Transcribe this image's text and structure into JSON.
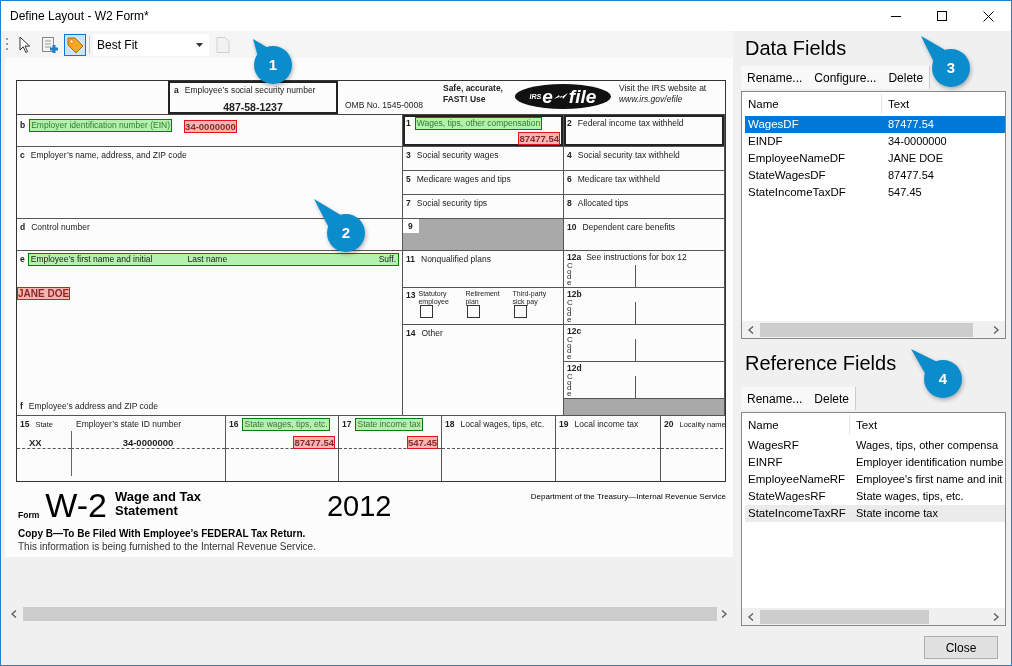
{
  "window": {
    "title": "Define Layout - W2 Form*"
  },
  "toolbar": {
    "tools": [
      {
        "kind": "pointer",
        "selected": false
      },
      {
        "kind": "add-field",
        "selected": false
      },
      {
        "kind": "tag",
        "selected": true
      }
    ],
    "zoom": "Best Fit",
    "page_button": {
      "disabled": true
    }
  },
  "form": {
    "ssn": {
      "letter": "a",
      "label": "Employee’s social security number",
      "value": "487-58-1237"
    },
    "omb": "OMB No. 1545-0008",
    "efile": {
      "note": "Safe, accurate, FAST! Use",
      "logo_badge": "IRS",
      "logo_left": "e",
      "logo_right": "file",
      "visit": "Visit the IRS website at",
      "url": "www.irs.gov/efile"
    },
    "left": [
      {
        "kind": "text",
        "num": "b",
        "label": "Employer identification number (EIN)",
        "label_tagged": true,
        "value": "34-0000000",
        "value_tagged": true
      },
      {
        "kind": "text",
        "num": "c",
        "label": "Employer’s name, address, and ZIP code",
        "label_tagged": false
      },
      {
        "kind": "text",
        "num": "d",
        "label": "Control number",
        "label_tagged": false
      },
      {
        "kind": "name",
        "num": "e",
        "labels": [
          "Employee’s first name and initial",
          "Last name",
          "Suff."
        ],
        "label_tagged": true,
        "value": "JANE DOE",
        "value_tagged": true,
        "footer_num": "f",
        "footer": "Employee’s address and ZIP code"
      }
    ],
    "middle": [
      {
        "kind": "text",
        "num": "1",
        "label": "Wages, tips, other compensation",
        "label_tagged": true,
        "value": "87477.54",
        "value_tagged": true
      },
      {
        "kind": "text",
        "num": "3",
        "label": "Social security wages",
        "label_tagged": false
      },
      {
        "kind": "text",
        "num": "5",
        "label": "Medicare wages and tips",
        "label_tagged": false
      },
      {
        "kind": "text",
        "num": "7",
        "label": "Social security tips",
        "label_tagged": false
      },
      {
        "kind": "shaded",
        "num": "9"
      },
      {
        "kind": "text",
        "num": "11",
        "label": "Nonqualified plans",
        "label_tagged": false
      },
      {
        "kind": "checkboxes",
        "num": "13",
        "options": [
          {
            "label": "Statutory employee",
            "checked": false
          },
          {
            "label": "Retirement plan",
            "checked": false
          },
          {
            "label": "Third-party sick pay",
            "checked": false
          }
        ]
      },
      {
        "kind": "text",
        "num": "14",
        "label": "Other",
        "label_tagged": false
      }
    ],
    "right": [
      {
        "kind": "text",
        "num": "2",
        "label": "Federal income tax withheld",
        "label_tagged": false
      },
      {
        "kind": "text",
        "num": "4",
        "label": "Social security tax withheld",
        "label_tagged": false
      },
      {
        "kind": "text",
        "num": "6",
        "label": "Medicare tax withheld",
        "label_tagged": false
      },
      {
        "kind": "text",
        "num": "8",
        "label": "Allocated tips",
        "label_tagged": false
      },
      {
        "kind": "text",
        "num": "10",
        "label": "Dependent care benefits",
        "label_tagged": false
      },
      {
        "kind": "code",
        "num": "12a",
        "label": "See instructions for box 12",
        "code": "Code"
      },
      {
        "kind": "code",
        "num": "12b",
        "code": "Code"
      },
      {
        "kind": "code",
        "num": "12c",
        "code": "Code"
      },
      {
        "kind": "code",
        "num": "12d",
        "code": "Code"
      },
      {
        "kind": "shaded"
      }
    ],
    "state": [
      {
        "kind": "state-id",
        "num": "15",
        "sub": "State",
        "sub_value": "XX",
        "label": "Employer’s state ID number",
        "value": "34-0000000"
      },
      {
        "kind": "text",
        "num": "16",
        "label": "State wages, tips, etc.",
        "label_tagged": true,
        "value": "87477.54",
        "value_tagged": true
      },
      {
        "kind": "text",
        "num": "17",
        "label": "State income tax",
        "label_tagged": true,
        "value": "547.45",
        "value_tagged": true
      },
      {
        "kind": "text",
        "num": "18",
        "label": "Local wages, tips, etc.",
        "label_tagged": false
      },
      {
        "kind": "text",
        "num": "19",
        "label": "Local income tax",
        "label_tagged": false
      },
      {
        "kind": "text",
        "num": "20",
        "label": "Locality name",
        "label_tagged": false
      }
    ],
    "footer": {
      "form_word": "Form",
      "form_name": "W-2",
      "title": "Wage and Tax Statement",
      "year": "2012",
      "dept": "Department of the Treasury—Internal Revenue Service",
      "copy": "Copy B—To Be Filed With Employee’s FEDERAL Tax Return.",
      "note": "This information is being furnished to the Internal Revenue Service."
    }
  },
  "data_fields": {
    "title": "Data Fields",
    "actions": [
      "Rename...",
      "Configure...",
      "Delete"
    ],
    "columns": [
      "Name",
      "Text"
    ],
    "rows": [
      {
        "name": "WagesDF",
        "text": "87477.54",
        "selected": true,
        "hovered": false
      },
      {
        "name": "EINDF",
        "text": "34-0000000",
        "selected": false,
        "hovered": false
      },
      {
        "name": "EmployeeNameDF",
        "text": "JANE DOE",
        "selected": false,
        "hovered": false
      },
      {
        "name": "StateWagesDF",
        "text": "87477.54",
        "selected": false,
        "hovered": false
      },
      {
        "name": "StateIncomeTaxDF",
        "text": "547.45",
        "selected": false,
        "hovered": false
      }
    ]
  },
  "reference_fields": {
    "title": "Reference Fields",
    "actions": [
      "Rename...",
      "Delete"
    ],
    "columns": [
      "Name",
      "Text"
    ],
    "rows": [
      {
        "name": "WagesRF",
        "text": "Wages, tips, other compensa",
        "selected": false,
        "hovered": false
      },
      {
        "name": "EINRF",
        "text": "Employer identification numbe",
        "selected": false,
        "hovered": false
      },
      {
        "name": "EmployeeNameRF",
        "text": "Employee's first name and init",
        "selected": false,
        "hovered": false
      },
      {
        "name": "StateWagesRF",
        "text": "State wages, tips, etc.",
        "selected": false,
        "hovered": false
      },
      {
        "name": "StateIncomeTaxRF",
        "text": "State income tax",
        "selected": false,
        "hovered": true
      }
    ]
  },
  "close_button": "Close",
  "callouts": [
    "1",
    "2",
    "3",
    "4"
  ]
}
